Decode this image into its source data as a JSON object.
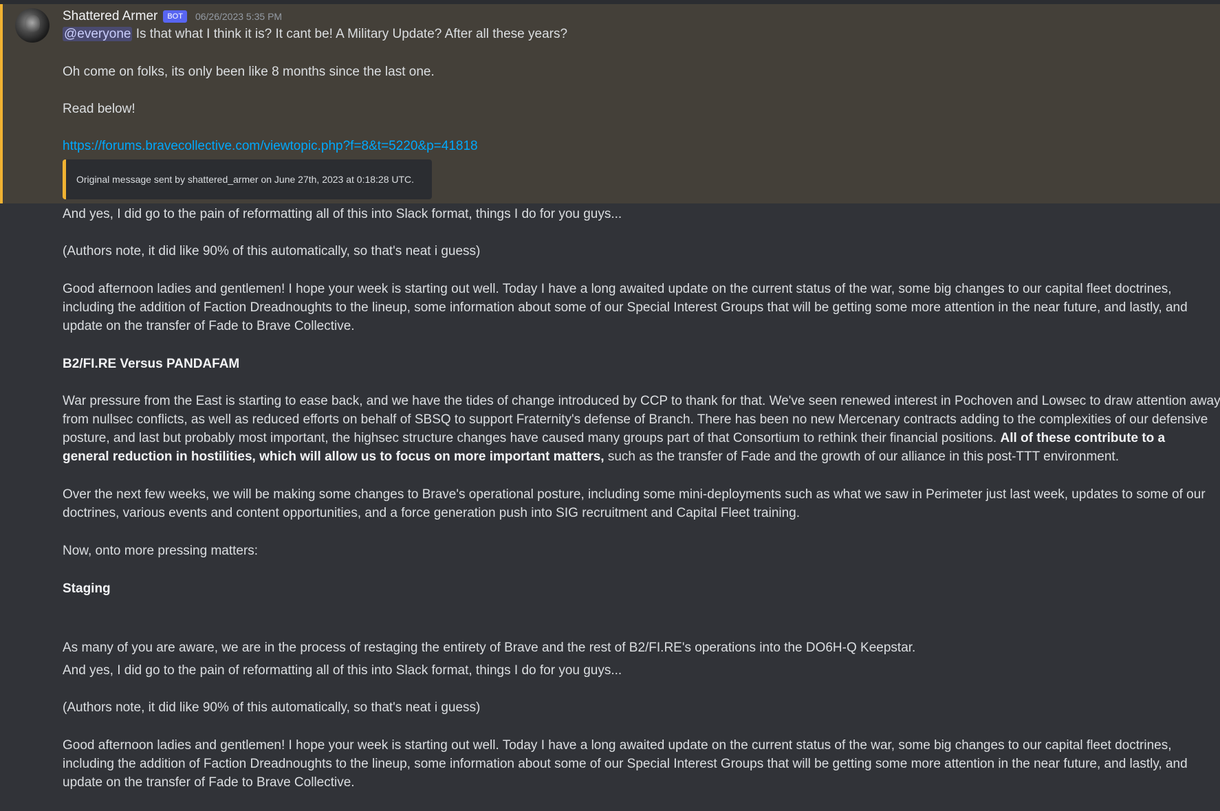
{
  "author": {
    "name": "Shattered Armer",
    "bot_tag": "BOT",
    "timestamp": "06/26/2023 5:35 PM"
  },
  "message": {
    "mention": "@everyone",
    "line1": "Is that what I think it is? It cant be! A Military Update? After all these years?",
    "line2": "Oh come on folks, its only been like 8 months since the last one.",
    "line3": "Read below!",
    "link": "https://forums.bravecollective.com/viewtopic.php?f=8&t=5220&p=41818",
    "original_note": "Original message sent by shattered_armer on June 27th, 2023 at 0:18:28 UTC."
  },
  "body": {
    "p1": "And yes, I did go to the pain of reformatting all of this into Slack format, things I do for you guys...",
    "p2": "(Authors note, it did like 90% of this automatically, so that's neat i guess)",
    "p3_l1": "Good afternoon ladies and gentlemen! I hope your week is starting out well. Today I have a long awaited update on the current status of the war, some big changes to our capital fleet doctrines,",
    "p3_l2": "including the addition of Faction Dreadnoughts to the lineup, some information about some of our Special Interest Groups that will be getting some more attention in the near future, and lastly, and",
    "p3_l3": "update on the transfer of Fade to Brave Collective.",
    "h1": "B2/FI.RE Versus PANDAFAM",
    "p4_l1": "War pressure from the East is starting to ease back, and we have the tides of change introduced by CCP to thank for that. We've seen renewed interest in Pochoven and Lowsec to draw attention away",
    "p4_l2": "from nullsec conflicts, as well as reduced efforts on behalf of SBSQ to support Fraternity's defense of Branch. There has been no new Mercenary contracts adding to the complexities of our defensive",
    "p4_l3a": "posture, and last but probably most important, the highsec structure changes have caused many groups part of that Consortium to rethink their financial positions.",
    "p4_l3b": "All of these contribute to a",
    "p4_l4a": "general reduction in hostilities, which will allow us to focus on more important matters,",
    "p4_l4b": "such as the transfer of Fade and the growth of our alliance in this post-TTT environment.",
    "p5_l1": "Over the next few weeks, we will be making some changes to Brave's operational posture, including some mini-deployments such as what we saw in Perimeter just last week, updates to some of our",
    "p5_l2": "doctrines, various events and content opportunities, and a force generation push into SIG recruitment and Capital Fleet training.",
    "p6": "Now, onto more pressing matters:",
    "h2": "Staging",
    "p7": "As many of you are aware, we are in the process of restaging the entirety of Brave and the rest of B2/FI.RE's operations into the DO6H-Q Keepstar.",
    "r1": "And yes, I did go to the pain of reformatting all of this into Slack format, things I do for you guys...",
    "r2": "(Authors note, it did like 90% of this automatically, so that's neat i guess)",
    "r3_l1": "Good afternoon ladies and gentlemen! I hope your week is starting out well. Today I have a long awaited update on the current status of the war, some big changes to our capital fleet doctrines,",
    "r3_l2": "including the addition of Faction Dreadnoughts to the lineup, some information about some of our Special Interest Groups that will be getting some more attention in the near future, and lastly, and",
    "r3_l3": "update on the transfer of Fade to Brave Collective."
  },
  "colors": {
    "background": "#313338",
    "highlight": "#444039",
    "highlight_border": "#f0b232",
    "link": "#00a8fc",
    "bot_tag": "#5865f2"
  }
}
